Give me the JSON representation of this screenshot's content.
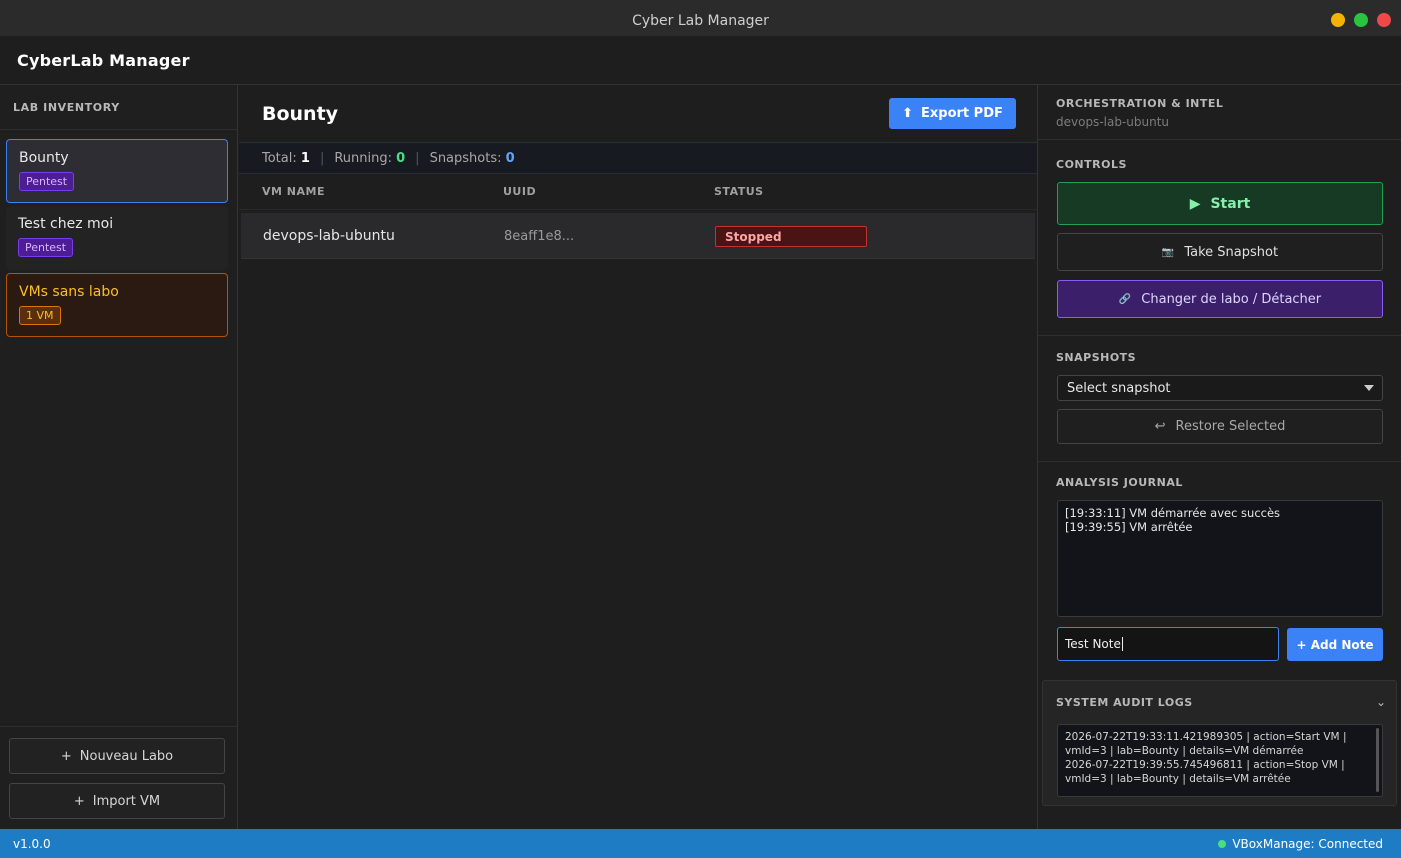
{
  "window": {
    "title": "Cyber Lab Manager",
    "controls": {
      "minimize_color": "#f5b301",
      "maximize_color": "#29c440",
      "close_color": "#f04848"
    }
  },
  "header": {
    "brand": "CyberLab Manager"
  },
  "sidebar": {
    "title": "LAB INVENTORY",
    "labs": [
      {
        "name": "Bounty",
        "tag": "Pentest",
        "state": "selected"
      },
      {
        "name": "Test chez moi",
        "tag": "Pentest",
        "state": "normal"
      },
      {
        "name": "VMs sans labo",
        "tag": "1 VM",
        "state": "orphan"
      }
    ],
    "new_lab_label": "Nouveau Labo",
    "import_vm_label": "Import VM",
    "plus_glyph": "+"
  },
  "main": {
    "title": "Bounty",
    "export_label": "Export PDF",
    "export_glyph": "⬆",
    "stats": {
      "total_label": "Total:",
      "total": "1",
      "running_label": "Running:",
      "running": "0",
      "snapshots_label": "Snapshots:",
      "snapshots": "0",
      "separator": "|"
    },
    "table": {
      "columns": [
        "VM NAME",
        "UUID",
        "STATUS"
      ],
      "rows": [
        {
          "name": "devops-lab-ubuntu",
          "uuid": "8eaff1e8...",
          "status": "Stopped"
        }
      ]
    }
  },
  "panel": {
    "title": "ORCHESTRATION & INTEL",
    "vm": "devops-lab-ubuntu",
    "controls_label": "CONTROLS",
    "start_label": "Start",
    "start_glyph": "▶",
    "snapshot_label": "Take Snapshot",
    "snapshot_glyph": "📷",
    "move_label": "Changer de labo / Détacher",
    "move_glyph": "🔗",
    "snapshots_label": "SNAPSHOTS",
    "snapshot_select": "Select snapshot",
    "restore_label": "Restore Selected",
    "restore_glyph": "↩",
    "journal_label": "ANALYSIS JOURNAL",
    "journal_entries": [
      "[19:33:11] VM démarrée avec succès",
      "[19:39:55] VM arrêtée"
    ],
    "note_value": "Test Note",
    "add_note_label": "+ Add Note",
    "audit_label": "SYSTEM AUDIT LOGS",
    "audit_chevron": "⌄",
    "audit_logs": [
      "2026-07-22T19:33:11.421989305 | action=Start VM |",
      "vmId=3 | lab=Bounty | details=VM démarrée",
      "2026-07-22T19:39:55.745496811 | action=Stop VM |",
      "vmId=3 | lab=Bounty | details=VM arrêtée"
    ]
  },
  "statusbar": {
    "version": "v1.0.0",
    "connection": "VBoxManage: Connected"
  },
  "colors": {
    "accent": "#3b82f6",
    "statusbar": "#1e7cc4",
    "running": "#4ade80",
    "stopped": "#c53030"
  }
}
